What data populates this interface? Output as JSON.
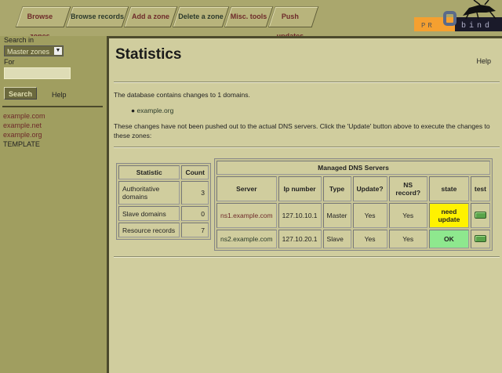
{
  "nav": {
    "tabs": [
      "Browse zones",
      "Browse records",
      "Add a zone",
      "Delete a zone",
      "Misc. tools",
      "Push updates"
    ]
  },
  "logo": {
    "text": "PROBIND",
    "left": "PR",
    "o": "O",
    "right": "bind"
  },
  "sidebar": {
    "search_in_label": "Search in",
    "search_in_value": "Master zones",
    "for_label": "For",
    "for_value": "",
    "search_button": "Search",
    "help": "Help",
    "zones": [
      "example.com",
      "example.net",
      "example.org",
      "TEMPLATE"
    ]
  },
  "main": {
    "title": "Statistics",
    "help": "Help",
    "changes_text": "The database contains changes to 1 domains.",
    "changed_domains": [
      "example.org"
    ],
    "not_pushed_text": "These changes have not been pushed out to the actual DNS servers. Click the 'Update' button above to execute the changes to these zones:",
    "stats": {
      "headers": [
        "Statistic",
        "Count"
      ],
      "rows": [
        [
          "Authoritative domains",
          "3"
        ],
        [
          "Slave domains",
          "0"
        ],
        [
          "Resource records",
          "7"
        ]
      ]
    },
    "servers": {
      "title": "Managed DNS Servers",
      "headers": [
        "Server",
        "Ip number",
        "Type",
        "Update?",
        "NS record?",
        "state",
        "test"
      ],
      "rows": [
        [
          "ns1.example.com",
          "127.10.10.1",
          "Master",
          "Yes",
          "Yes",
          "need update"
        ],
        [
          "ns2.example.com",
          "127.10.20.1",
          "Slave",
          "Yes",
          "Yes",
          "OK"
        ]
      ]
    }
  },
  "colors": {
    "need_update": "#fff200",
    "ok": "#8ee88e",
    "link": "#6e2a2a"
  }
}
